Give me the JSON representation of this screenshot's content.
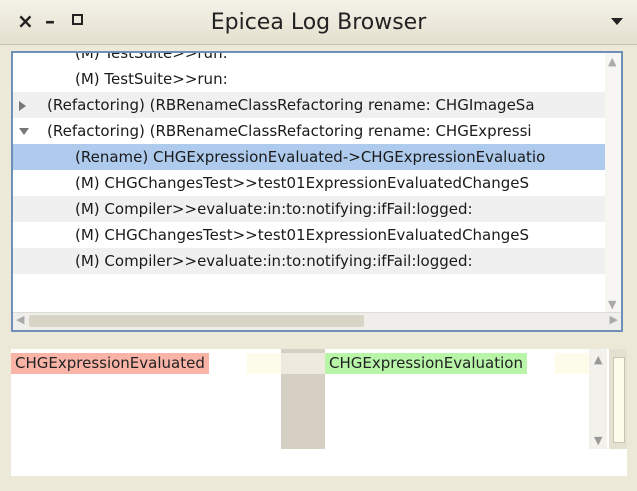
{
  "window": {
    "title": "Epicea Log Browser",
    "close_glyph": "×",
    "minimize_glyph": "–",
    "icons": [
      "close-icon",
      "minimize-icon",
      "maximize-icon",
      "window-menu-icon"
    ]
  },
  "log_list": {
    "rows": [
      {
        "text": "(M) TestSuite>>run:",
        "state": "partial"
      },
      {
        "text": "(M) TestSuite>>run:",
        "state": "normal"
      },
      {
        "text": "(Refactoring) (RBRenameClassRefactoring rename: CHGImageSa",
        "state": "collapsed"
      },
      {
        "text": "(Refactoring) (RBRenameClassRefactoring rename: CHGExpressi",
        "state": "expanded"
      },
      {
        "text": "(Rename) CHGExpressionEvaluated->CHGExpressionEvaluatio",
        "state": "selected"
      },
      {
        "text": "(M) CHGChangesTest>>test01ExpressionEvaluatedChangeS",
        "state": "normal"
      },
      {
        "text": "(M) Compiler>>evaluate:in:to:notifying:ifFail:logged:",
        "state": "normal"
      },
      {
        "text": "(M) CHGChangesTest>>test01ExpressionEvaluatedChangeS",
        "state": "normal"
      },
      {
        "text": "(M) Compiler>>evaluate:in:to:notifying:ifFail:logged:",
        "state": "normal"
      }
    ]
  },
  "diff": {
    "left_text": "CHGExpressionEvaluated",
    "right_text": "CHGExpressionEvaluation",
    "removed_color": "#f9b4a7",
    "added_color": "#b9f5a9"
  }
}
